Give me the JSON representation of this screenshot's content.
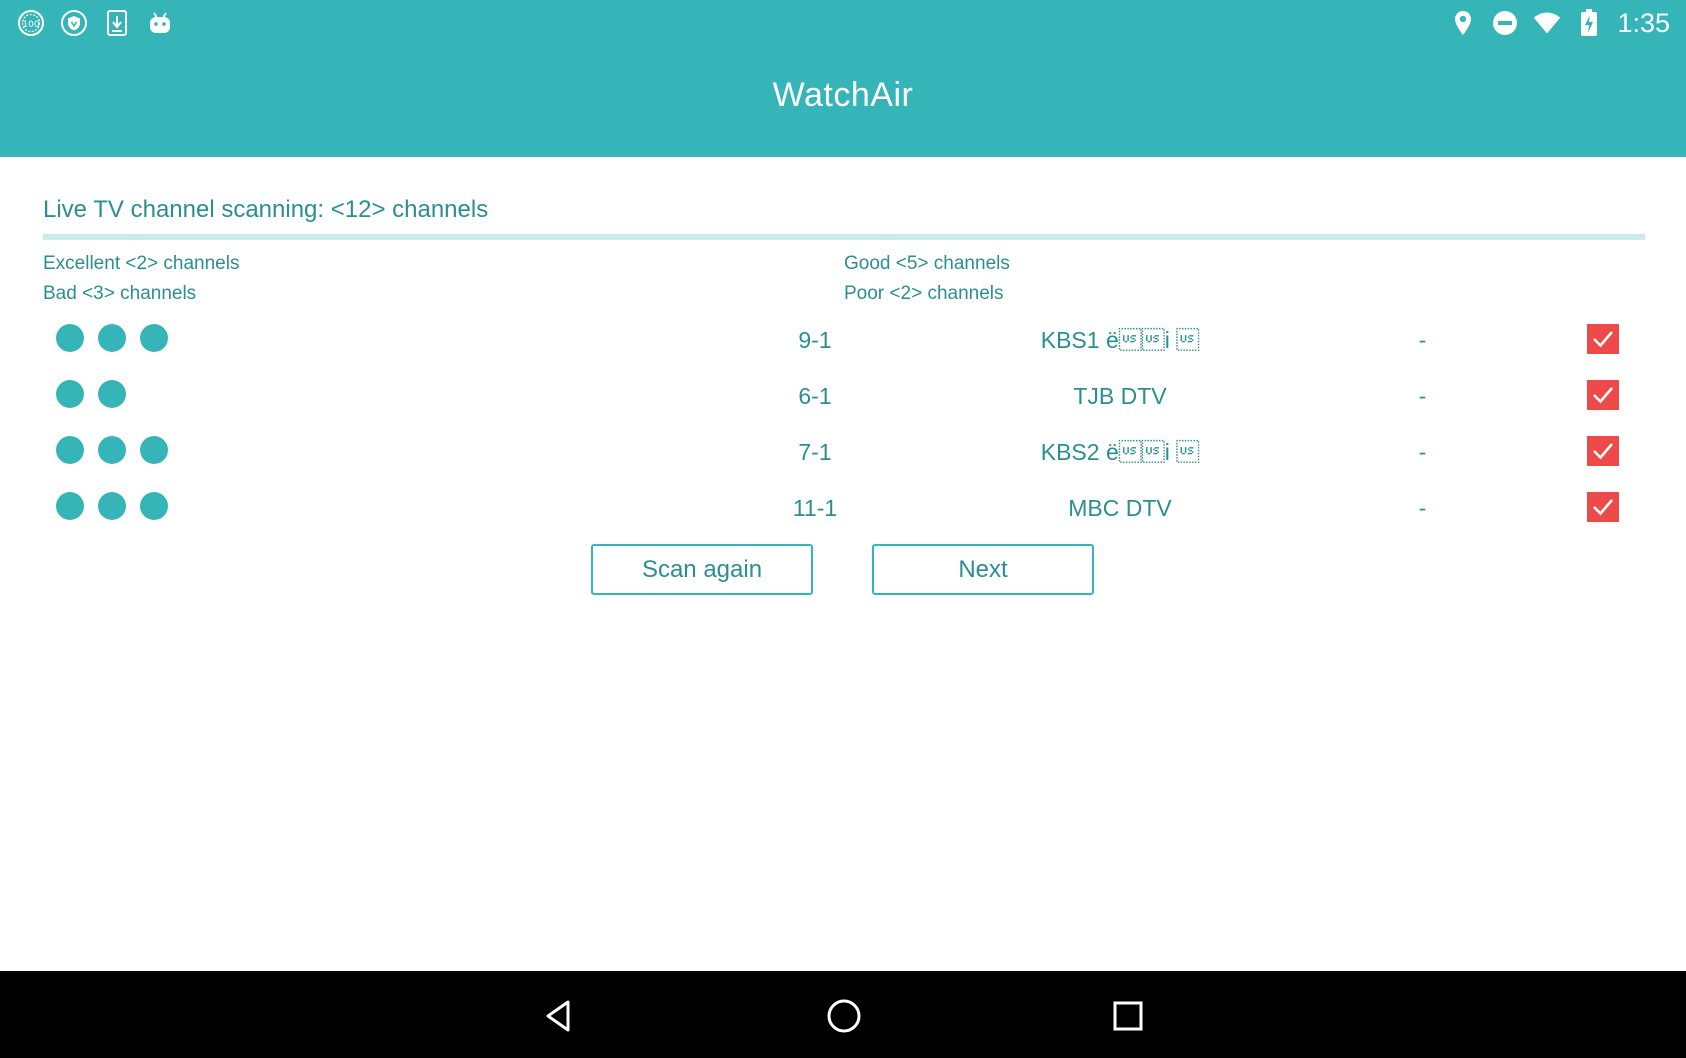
{
  "status_bar": {
    "left_icons": [
      "battery-100-icon",
      "shield-icon",
      "download-icon",
      "android-icon"
    ],
    "right_icons": [
      "location-icon",
      "do-not-disturb-icon",
      "wifi-icon",
      "battery-charging-icon"
    ],
    "time": "1:35"
  },
  "app": {
    "title": "WatchAir"
  },
  "scan": {
    "title": "Live TV channel scanning: <12> channels",
    "excellent": "Excellent <2> channels",
    "good": "Good <5> channels",
    "bad": "Bad <3> channels",
    "poor": "Poor <2> channels"
  },
  "channels": [
    {
      "signal_dots": 3,
      "number": "9-1",
      "name": "KBS1 ë\u001f\u001fi \u001f",
      "extra": "-",
      "checked": true
    },
    {
      "signal_dots": 2,
      "number": "6-1",
      "name": "TJB DTV",
      "extra": "-",
      "checked": true
    },
    {
      "signal_dots": 3,
      "number": "7-1",
      "name": "KBS2 ë\u001f\u001fi \u001f",
      "extra": "-",
      "checked": true
    },
    {
      "signal_dots": 3,
      "number": "11-1",
      "name": "MBC DTV",
      "extra": "-",
      "checked": true
    }
  ],
  "buttons": {
    "scan_again": "Scan again",
    "next": "Next"
  },
  "nav": {
    "icons": [
      "back-icon",
      "home-icon",
      "recents-icon"
    ]
  },
  "colors": {
    "accent": "#36b5b9",
    "text": "#2a8f93",
    "check": "#ef4a4a",
    "navbar": "#000000"
  }
}
